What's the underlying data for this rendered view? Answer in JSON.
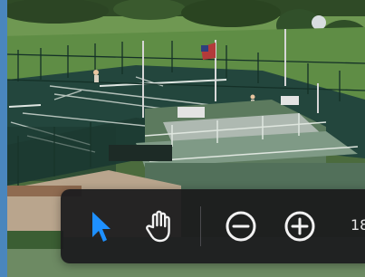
{
  "colors": {
    "toolbar_background": "#1c1c1e",
    "active_tool": "#1e90ff",
    "icon": "#f2f2f2",
    "separator": "#4a4a4e"
  },
  "toolbar": {
    "tools": [
      {
        "name": "select",
        "icon": "pointer-arrow-icon",
        "active": true
      },
      {
        "name": "pan",
        "icon": "hand-icon",
        "active": false
      },
      {
        "name": "zoom-out",
        "icon": "zoom-out-icon",
        "active": false
      },
      {
        "name": "zoom-in",
        "icon": "zoom-in-icon",
        "active": false
      }
    ],
    "zoom_label": "18"
  }
}
